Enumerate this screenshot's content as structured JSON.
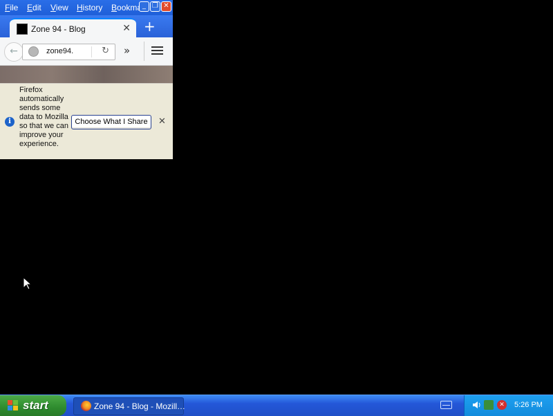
{
  "firefox": {
    "menu": [
      "File",
      "Edit",
      "View",
      "History",
      "Bookmar"
    ],
    "menu_access_keys": [
      "F",
      "E",
      "V",
      "H",
      "B"
    ],
    "window_buttons": {
      "minimize": "_",
      "restore": "❐",
      "close": "✕"
    },
    "tab": {
      "title": "Zone 94 - Blog",
      "close": "✕"
    },
    "new_tab": "+",
    "url": "zone94.",
    "back": "←",
    "reload": "↻",
    "overflow": "»",
    "notification": {
      "text": "Firefox automatically sends some data to Mozilla so that we can improve your experience.",
      "button": "Choose What I Share",
      "close": "✕",
      "info": "i"
    }
  },
  "taskbar": {
    "start": "start",
    "task_button": "Zone 94 - Blog - Mozill…",
    "clock": "5:26 PM"
  },
  "colors": {
    "desktop": "#000000",
    "xp_blue": "#245edb",
    "start_green": "#3c9a3c",
    "firefox_accent": "#0a84ff"
  },
  "icons": [
    "back-arrow-icon",
    "globe-icon",
    "reload-icon",
    "overflow-icon",
    "hamburger-menu-icon",
    "info-icon",
    "close-icon",
    "windows-logo-icon",
    "firefox-icon",
    "keyboard-icon",
    "volume-icon",
    "network-icon",
    "security-shield-icon",
    "mouse-cursor-icon"
  ]
}
